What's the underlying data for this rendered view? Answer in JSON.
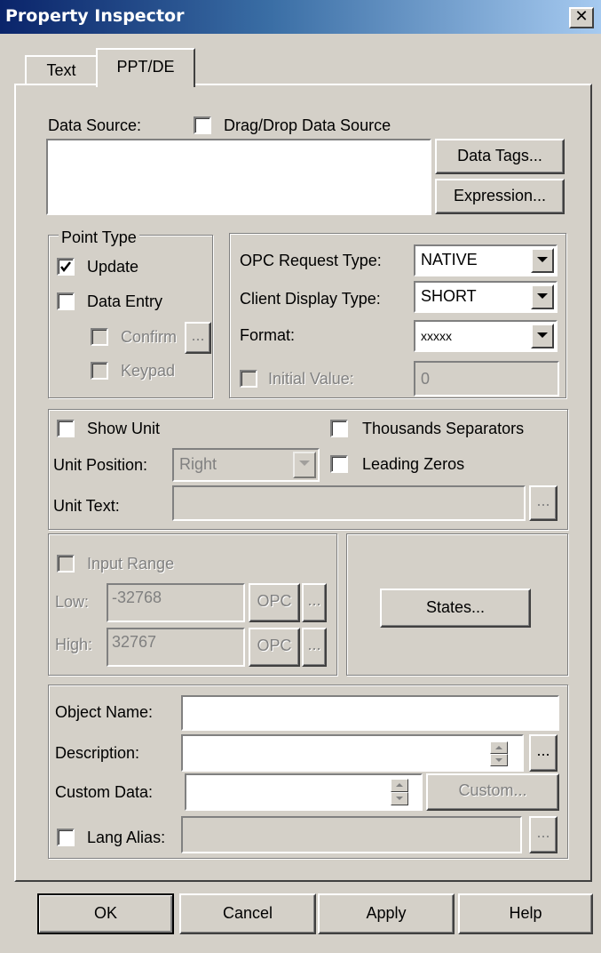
{
  "window": {
    "title": "Property Inspector",
    "close_glyph": "✕",
    "close_icon": "close-icon"
  },
  "tabs": [
    {
      "label": "Text"
    },
    {
      "label": "PPT/DE",
      "active": true
    }
  ],
  "data_source": {
    "label": "Data Source:",
    "drag_drop_label": "Drag/Drop Data Source",
    "drag_drop_checked": false,
    "value": "",
    "data_tags_button": "Data Tags...",
    "expression_button": "Expression..."
  },
  "point_type": {
    "legend": "Point Type",
    "update": {
      "label": "Update",
      "checked": true
    },
    "data_entry": {
      "label": "Data Entry",
      "checked": false
    },
    "confirm": {
      "label": "Confirm",
      "checked": false,
      "button": "..."
    },
    "keypad": {
      "label": "Keypad",
      "checked": false
    }
  },
  "opc": {
    "request_type": {
      "label": "OPC Request Type:",
      "value": "NATIVE"
    },
    "client_display_type": {
      "label": "Client Display Type:",
      "value": "SHORT"
    },
    "format": {
      "label": "Format:",
      "value": "xxxxx"
    },
    "initial_value": {
      "label": "Initial Value:",
      "value": "0",
      "checked": false
    }
  },
  "units": {
    "show_unit": {
      "label": "Show Unit",
      "checked": false
    },
    "thousands_separators": {
      "label": "Thousands Separators",
      "checked": false
    },
    "unit_position": {
      "label": "Unit Position:",
      "value": "Right"
    },
    "leading_zeros": {
      "label": "Leading Zeros",
      "checked": false
    },
    "unit_text": {
      "label": "Unit Text:",
      "value": "",
      "button": "..."
    }
  },
  "input_range": {
    "label": "Input Range",
    "checked": false,
    "low": {
      "label": "Low:",
      "value": "-32768",
      "opc_button": "OPC",
      "more_button": "..."
    },
    "high": {
      "label": "High:",
      "value": "32767",
      "opc_button": "OPC",
      "more_button": "..."
    }
  },
  "states_button": "States...",
  "object": {
    "name": {
      "label": "Object Name:",
      "value": ""
    },
    "description": {
      "label": "Description:",
      "value": "",
      "button": "..."
    },
    "custom_data": {
      "label": "Custom Data:",
      "value": "",
      "button": "Custom..."
    },
    "lang_alias": {
      "label": "Lang Alias:",
      "value": "",
      "checked": false,
      "button": "..."
    }
  },
  "footer": {
    "ok": "OK",
    "cancel": "Cancel",
    "apply": "Apply",
    "help": "Help"
  }
}
